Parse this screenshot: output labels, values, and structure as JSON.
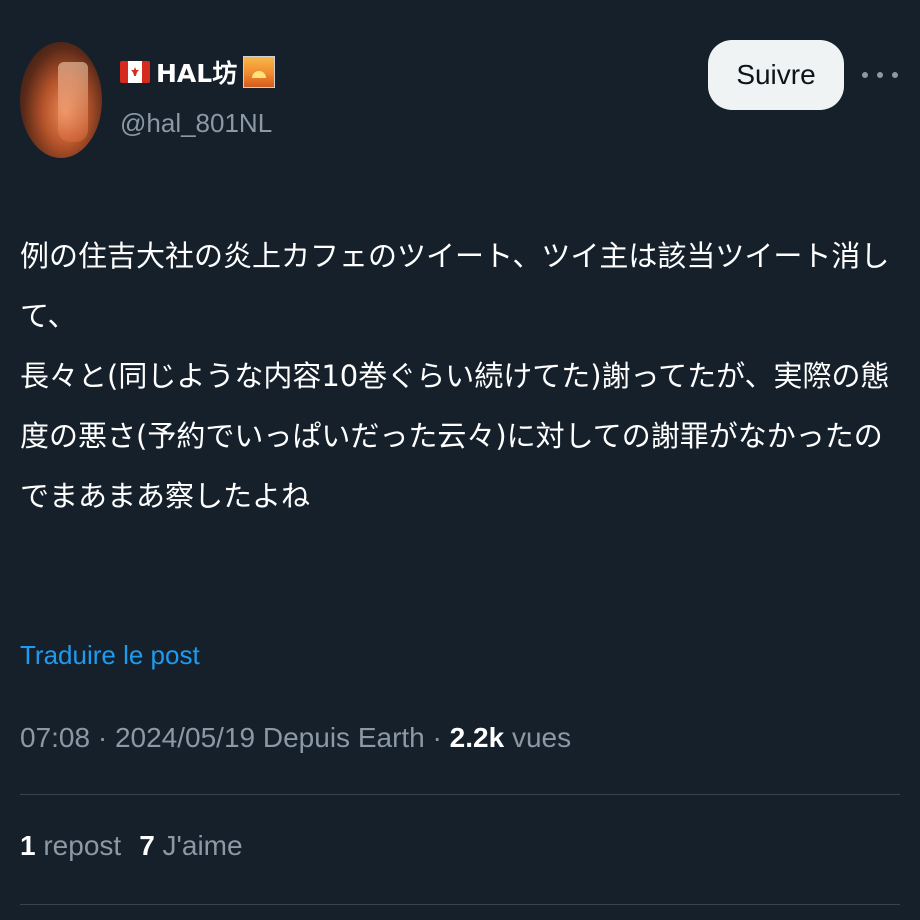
{
  "author": {
    "display_name": "HAL坊",
    "handle": "@hal_801NL",
    "flag_icon": "canada-flag-icon",
    "emoji_icon": "sunrise-icon"
  },
  "header": {
    "follow_label": "Suivre",
    "more_icon": "ellipsis-icon"
  },
  "tweet": {
    "text": "例の住吉大社の炎上カフェのツイート、ツイ主は該当ツイート消して、\n長々と(同じような内容10巻ぐらい続けてた)謝ってたが、実際の態度の悪さ(予約でいっぱいだった云々)に対しての謝罪がなかったのでまあまあ察したよね",
    "translate_label": "Traduire le post"
  },
  "meta": {
    "time": "07:08",
    "sep": "·",
    "date": "2024/05/19",
    "source": "Depuis Earth",
    "views_count": "2.2k",
    "views_label": "vues"
  },
  "stats": {
    "reposts_count": "1",
    "reposts_label": "repost",
    "likes_count": "7",
    "likes_label": "J'aime"
  },
  "colors": {
    "background": "#15202b",
    "secondary_text": "#8b98a5",
    "link": "#1d9bf0",
    "button_bg": "#eff3f4",
    "divider": "#38444d"
  }
}
